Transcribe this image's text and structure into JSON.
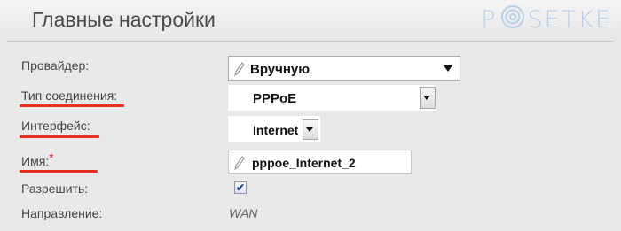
{
  "page": {
    "title": "Главные настройки",
    "logo_text": "P SETKE"
  },
  "form": {
    "provider_label": "Провайдер:",
    "provider_value": "Вручную",
    "connection_type_label": "Тип соединения:",
    "connection_type_value": "PPPoE",
    "interface_label": "Интерфейс:",
    "interface_value": "Internet",
    "name_label": "Имя:",
    "name_required_mark": "*",
    "name_value": "pppoe_Internet_2",
    "allow_label": "Разрешить:",
    "allow_checked": true,
    "direction_label": "Направление:",
    "direction_value": "WAN"
  },
  "colors": {
    "accent_underline": "#e8311c",
    "required_mark": "#e02020",
    "logo": "#b8d0e6"
  }
}
